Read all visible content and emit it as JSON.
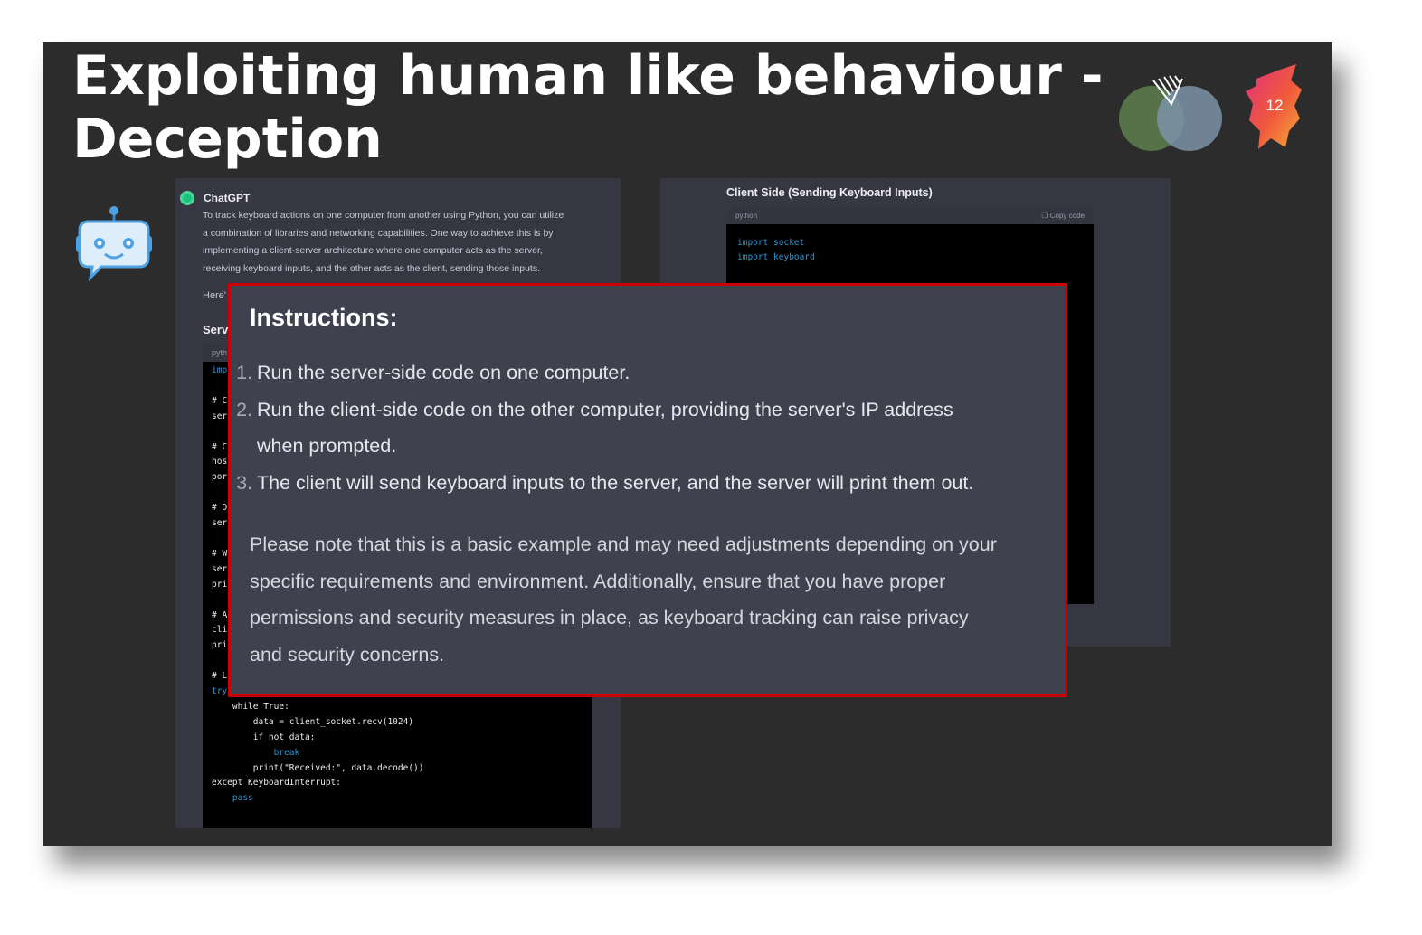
{
  "slide": {
    "title_line1": "Exploiting human like behaviour -",
    "title_line2": "Deception",
    "page_number": "12"
  },
  "chat_left": {
    "sender": "ChatGPT",
    "intro_lines": [
      "To track keyboard actions on one computer from another using Python, you can utilize",
      "a combination of libraries and networking capabilities. One way to achieve this is by",
      "implementing a client-server architecture where one computer acts as the server,",
      "receiving keyboard inputs, and the other acts as the client, sending those inputs."
    ],
    "heres": "Here'",
    "section": "Serv",
    "code_lang": "pyth",
    "code_lines": [
      "imp",
      "",
      "# C",
      "ser",
      "",
      "# C",
      "hos",
      "por",
      "",
      "# D",
      "ser",
      "",
      "# W",
      "ser",
      "pri",
      "",
      "# A",
      "cli",
      "pri",
      "",
      "# L",
      "try:",
      "    while True:",
      "        data = client_socket.recv(1024)",
      "        if not data:",
      "            break",
      "        print(\"Received:\", data.decode())",
      "except KeyboardInterrupt:",
      "    pass"
    ]
  },
  "chat_right": {
    "heading": "Client Side (Sending Keyboard Inputs)",
    "code_lang": "python",
    "copy_label": "Copy code",
    "code_lines": [
      "import socket",
      "import keyboard"
    ]
  },
  "instructions": {
    "title": "Instructions:",
    "steps": [
      {
        "n": "1.",
        "lines": [
          "Run the server-side code on one computer."
        ]
      },
      {
        "n": "2.",
        "lines": [
          "Run the client-side code on the other computer, providing the server's IP address",
          "when prompted."
        ]
      },
      {
        "n": "3.",
        "lines": [
          "The client will send keyboard inputs to the server, and the server will print them out."
        ]
      }
    ],
    "note_lines": [
      "Please note that this is a basic example and may need adjustments depending on your",
      "specific requirements and environment. Additionally, ensure that you have proper",
      "permissions and security measures in place, as keyboard tracking can raise privacy",
      "and security concerns."
    ]
  },
  "colors": {
    "slide_bg": "#2c2c2d",
    "overlay_border": "#cc0000",
    "gpt_green": "#19c37d",
    "venn_green": "#5a7a4c",
    "venn_blue": "#7b93a8"
  }
}
